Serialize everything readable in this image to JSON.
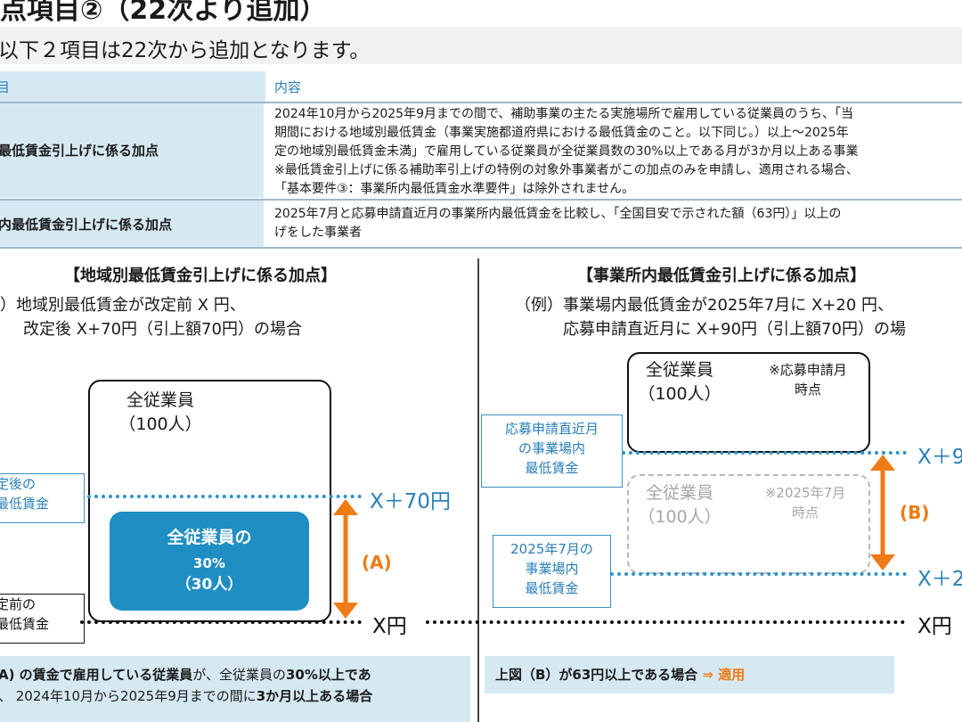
{
  "header": {
    "title": "点項目②（22次より追加）",
    "subtitle": "以下２項目は22次から追加となります。"
  },
  "table": {
    "col_item": "目",
    "col_content": "内容",
    "rows": [
      {
        "label": "最低賃金引上げに係る加点",
        "lines": [
          "2024年10月から2025年9月までの間で、補助事業の主たる実施場所で雇用している従業員のうち、「当",
          "期間における地域別最低賃金（事業実施都道府県における最低賃金のこと。以下同じ。）以上～2025年",
          "定の地域別最低賃金未満」で雇用している従業員が全従業員数の30%以上である月が3か月以上ある事業",
          "※最低賃金引上げに係る補助率引上げの特例の対象外事業者がこの加点のみを申請し、適用される場合、",
          "「基本要件③：事業所内最低賃金水準要件」は除外されません。"
        ]
      },
      {
        "label": "内最低賃金引上げに係る加点",
        "lines": [
          "2025年7月と応募申請直近月の事業所内最低賃金を比較し、「全国目安で示された額（63円）」以上の",
          "げをした事業者"
        ]
      }
    ]
  },
  "left": {
    "heading": "【地域別最低賃金引上げに係る加点】",
    "example_line1": "）地域別最低賃金が改定前 X 円、",
    "example_line2": "改定後 X+70円（引上額70円）の場合",
    "box_label1": "全従業員",
    "box_label2": "（100人）",
    "fill_label1": "全従業員の",
    "fill_label2": "30%",
    "fill_label3": "（30人）",
    "after_label1": "定後の",
    "after_label2": "最低賃金",
    "before_label1": "定前の",
    "before_label2": "最低賃金",
    "line_top": "X＋70円",
    "line_bottom": "X円",
    "arrow_label": "(A)",
    "result_line1_a": "A) の賃金で雇用している従業員",
    "result_line1_b": "が、全従業員の",
    "result_line1_c": "30%以上であ",
    "result_line2_a": "、 2024年10月から2025年9月までの間に",
    "result_line2_b": "3か月以上ある場合"
  },
  "right": {
    "heading": "【事業所内最低賃金引上げに係る加点】",
    "example_line1": "（例）事業場内最低賃金が2025年7月に X+20 円、",
    "example_line2": "応募申請直近月に X+90円（引上額70円）の場",
    "box_top_label1": "全従業員",
    "box_top_label2": "（100人）",
    "box_top_note1": "※応募申請月",
    "box_top_note2": "時点",
    "box_gray_label1": "全従業員",
    "box_gray_label2": "（100人）",
    "box_gray_note1": "※2025年7月",
    "box_gray_note2": "時点",
    "recent_label1": "応募申請直近月",
    "recent_label2": "の事業場内",
    "recent_label3": "最低賃金",
    "july_label1": "2025年7月の",
    "july_label2": "事業場内",
    "july_label3": "最低賃金",
    "line_top": "X＋9",
    "line_mid": "X＋2",
    "line_bottom": "X円",
    "arrow_label": "(B)",
    "result_a": "上図（B）が63円以上である場合",
    "result_arrow": "⇒",
    "result_b": "適用"
  },
  "colors": {
    "accent_blue": "#1f8ec3",
    "light_blue": "#d6e9f3",
    "orange": "#ee7b15"
  }
}
